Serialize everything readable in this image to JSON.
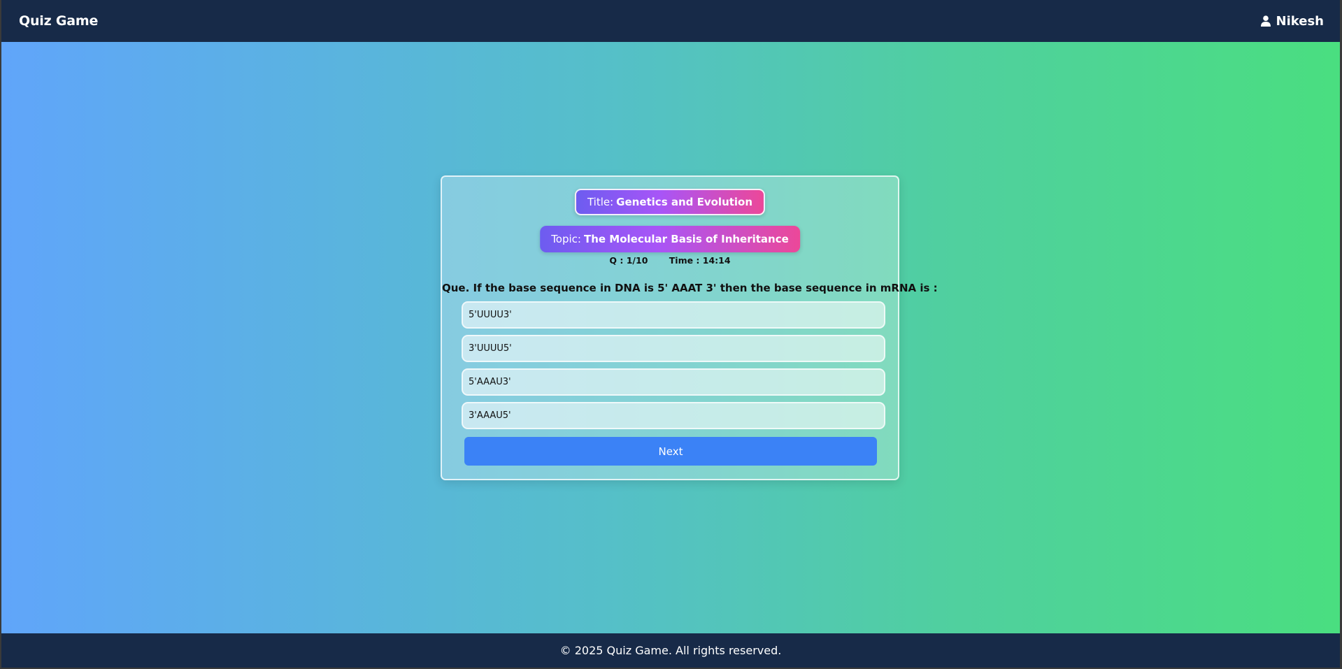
{
  "app": {
    "brand": "Quiz Game",
    "user_name": "Nikesh"
  },
  "quiz": {
    "title_label": "Title:",
    "title_value": "Genetics and Evolution",
    "topic_label": "Topic:",
    "topic_value": "The Molecular Basis of Inheritance",
    "question_counter": "Q : 1/10",
    "timer": "Time : 14:14",
    "question": "Que. If the base sequence in DNA is 5' AAAT 3' then the base sequence in mRNA is :",
    "options": [
      "5'UUUU3'",
      "3'UUUU5'",
      "5'AAAU3'",
      "3'AAAU5'"
    ],
    "next_label": "Next"
  },
  "footer": {
    "text": "© 2025 Quiz Game. All rights reserved."
  },
  "colors": {
    "navbar": "#172a48",
    "gradient_start": "#60a5fa",
    "gradient_end": "#4ade80",
    "pill_start": "#6d5cf0",
    "pill_end": "#ec4899",
    "next_button": "#3b82f6"
  },
  "icons": {
    "user": "user-icon"
  }
}
